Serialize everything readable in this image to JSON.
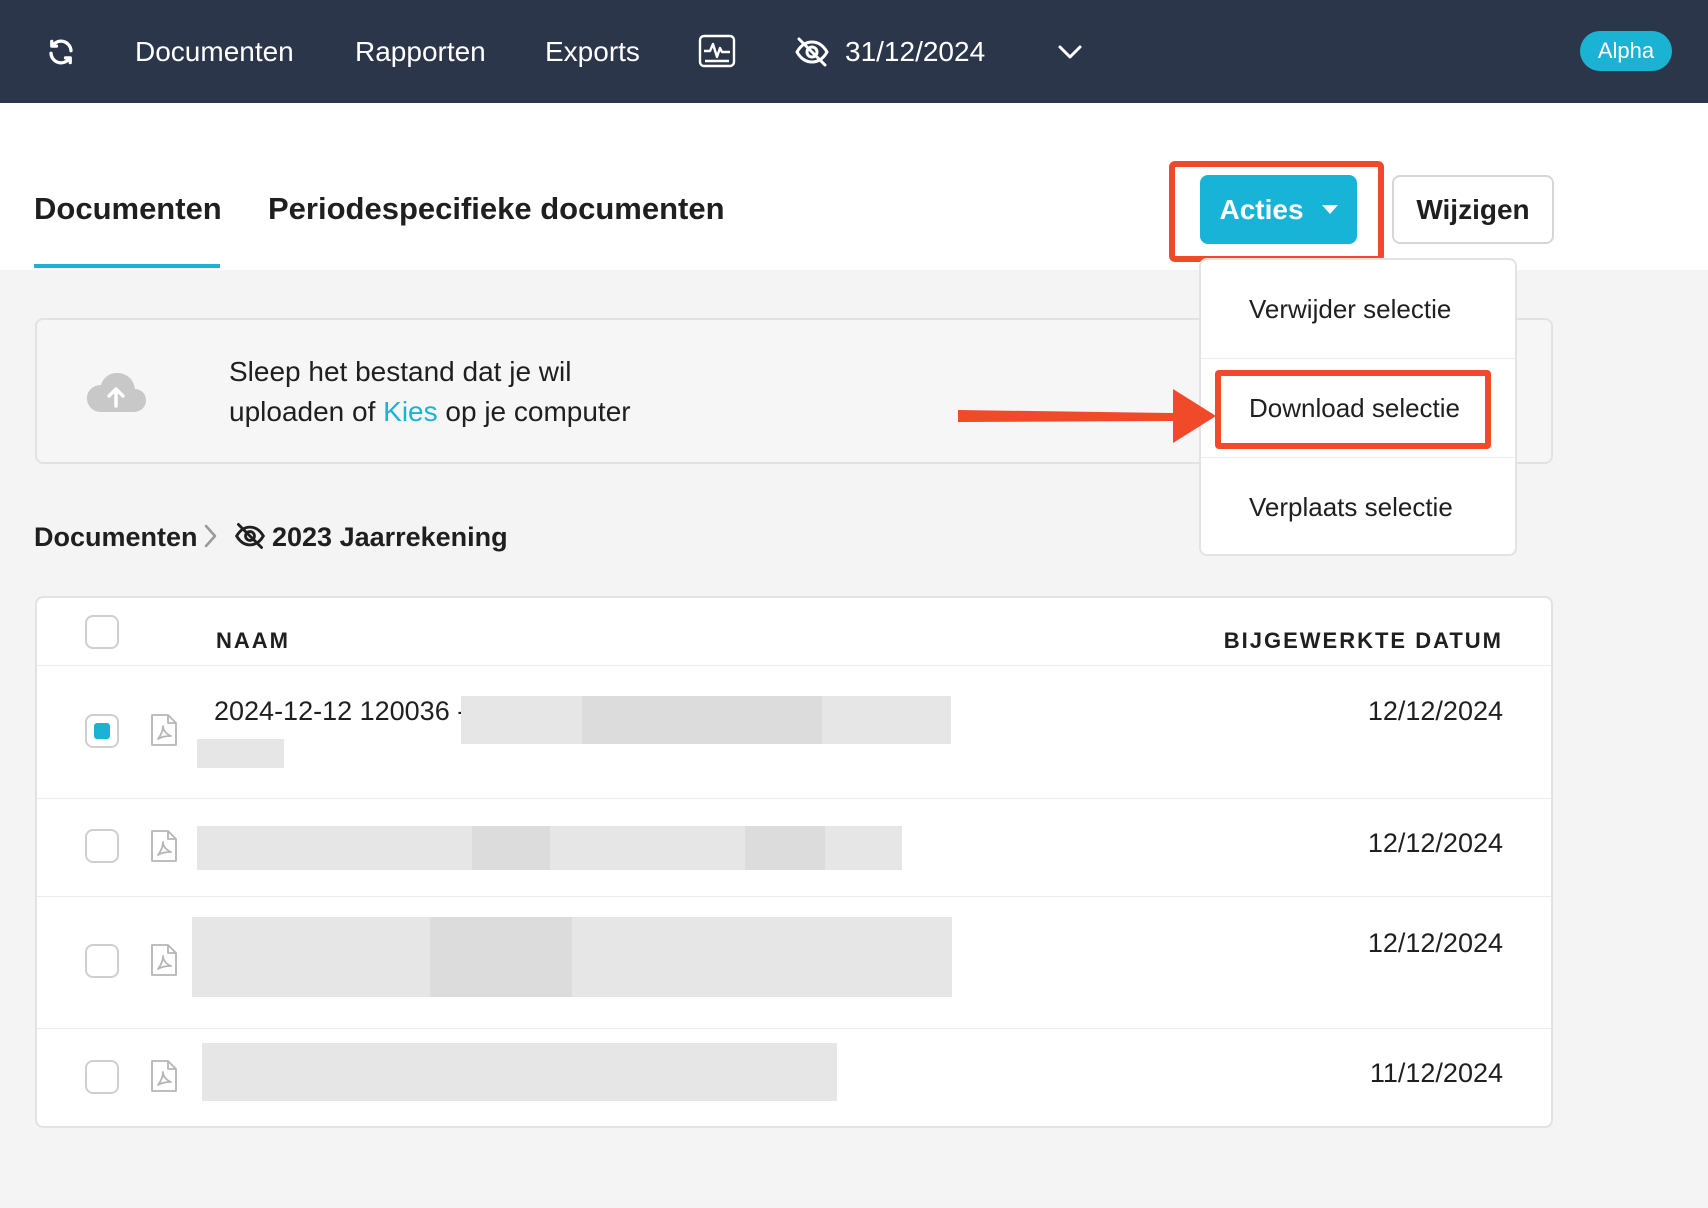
{
  "nav": {
    "links": [
      "Documenten",
      "Rapporten",
      "Exports"
    ],
    "date": "31/12/2024",
    "badge": "Alpha"
  },
  "tabs": {
    "documenten": "Documenten",
    "period": "Periodespecifieke documenten"
  },
  "buttons": {
    "acties": "Acties",
    "wijzigen": "Wijzigen"
  },
  "upload": {
    "line1": "Sleep het bestand dat je wil",
    "line2_pre": "uploaden of",
    "link": "Kies",
    "line2_post": "op je computer"
  },
  "breadcrumb": {
    "root": "Documenten",
    "folder": "2023 Jaarrekening"
  },
  "table": {
    "headers": {
      "name": "NAAM",
      "date": "BIJGEWERKTE DATUM"
    },
    "rows": [
      {
        "name": "2024-12-12 120036 -",
        "date": "12/12/2024",
        "checked": true
      },
      {
        "name": "",
        "date": "12/12/2024",
        "checked": false
      },
      {
        "name": "",
        "date": "12/12/2024",
        "checked": false
      },
      {
        "name": "",
        "date": "11/12/2024",
        "checked": false
      }
    ]
  },
  "dropdown": {
    "items": [
      "Verwijder selectie",
      "Download selectie",
      "Verplaats selectie"
    ]
  },
  "colors": {
    "nav_bg": "#2b364a",
    "accent": "#1bb3d4",
    "highlight": "#f04a2a"
  },
  "icons": [
    "refresh-icon",
    "activity-monitor-icon",
    "eye-slash-icon",
    "chevron-down-icon",
    "cloud-upload-icon",
    "chevron-right-icon",
    "pdf-file-icon",
    "caret-down-icon"
  ]
}
